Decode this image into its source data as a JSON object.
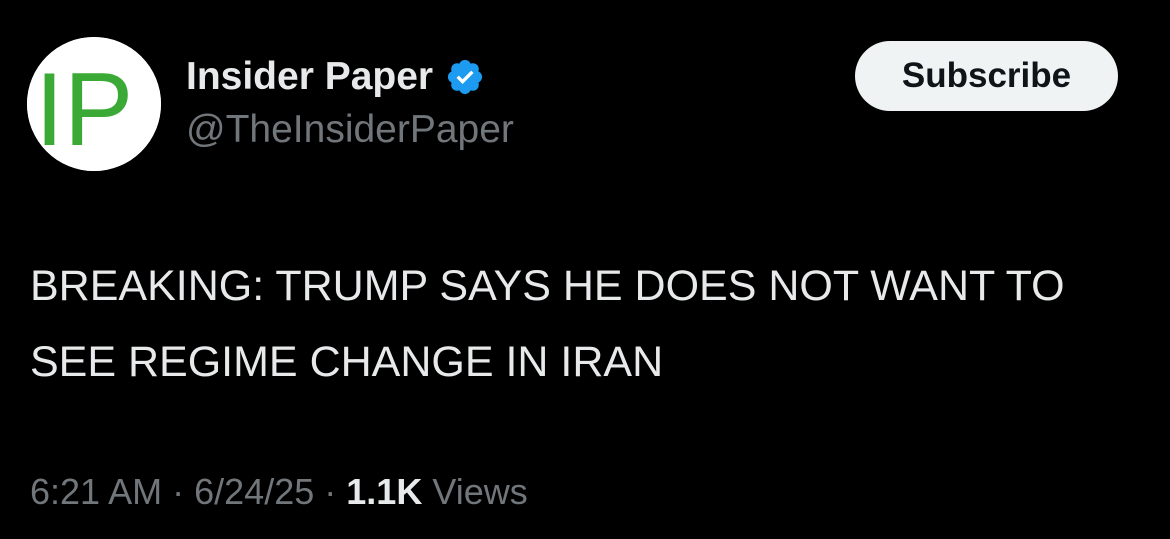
{
  "account": {
    "avatar_text": "IP",
    "display_name": "Insider Paper",
    "handle": "@TheInsiderPaper",
    "verified": true
  },
  "actions": {
    "subscribe_label": "Subscribe"
  },
  "tweet": {
    "text": "BREAKING: TRUMP SAYS HE DOES NOT WANT TO SEE REGIME CHANGE IN IRAN"
  },
  "meta": {
    "time": "6:21 AM",
    "separator": "·",
    "date": "6/24/25",
    "views_count": "1.1K",
    "views_label": "Views"
  },
  "colors": {
    "background": "#000000",
    "primary_text": "#e7e9ea",
    "secondary_text": "#71767b",
    "verified_badge": "#1d9bf0",
    "logo_green": "#3aa935",
    "button_bg": "#eff3f4"
  },
  "icons": {
    "verified": "verified-badge-icon"
  }
}
